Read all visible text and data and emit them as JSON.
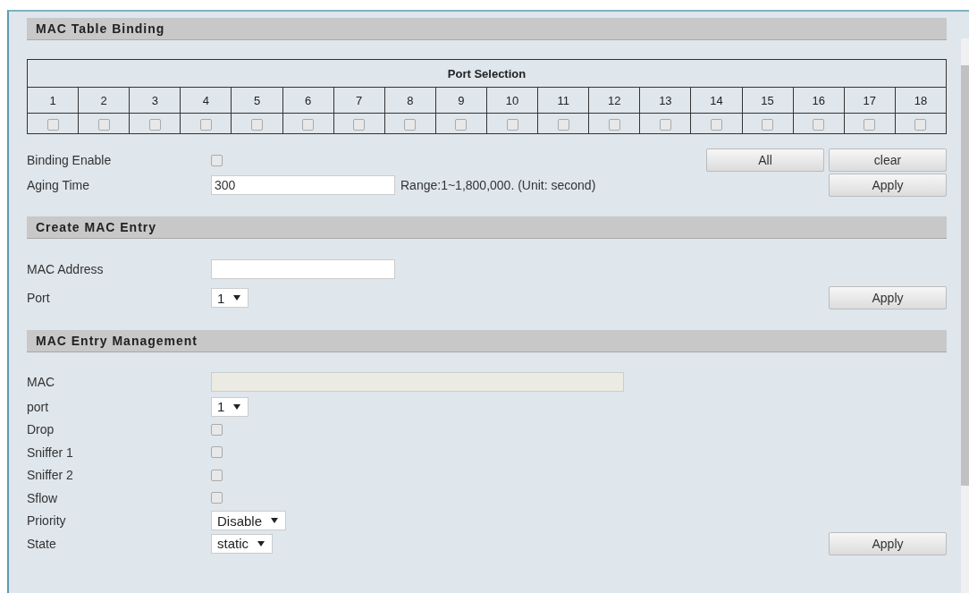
{
  "binding": {
    "title": "MAC Table Binding",
    "port_selection": {
      "title": "Port Selection",
      "ports": [
        {
          "label": "1",
          "checked": false
        },
        {
          "label": "2",
          "checked": false
        },
        {
          "label": "3",
          "checked": false
        },
        {
          "label": "4",
          "checked": false
        },
        {
          "label": "5",
          "checked": false
        },
        {
          "label": "6",
          "checked": false
        },
        {
          "label": "7",
          "checked": false
        },
        {
          "label": "8",
          "checked": false
        },
        {
          "label": "9",
          "checked": false
        },
        {
          "label": "10",
          "checked": false
        },
        {
          "label": "11",
          "checked": false
        },
        {
          "label": "12",
          "checked": false
        },
        {
          "label": "13",
          "checked": false
        },
        {
          "label": "14",
          "checked": false
        },
        {
          "label": "15",
          "checked": false
        },
        {
          "label": "16",
          "checked": false
        },
        {
          "label": "17",
          "checked": false
        },
        {
          "label": "18",
          "checked": false
        }
      ]
    },
    "binding_enable": {
      "label": "Binding Enable",
      "checked": false
    },
    "aging_time": {
      "label": "Aging Time",
      "value": "300",
      "hint": "Range:1~1,800,000. (Unit: second)"
    },
    "buttons": {
      "all": "All",
      "clear": "clear",
      "apply": "Apply"
    }
  },
  "create": {
    "title": "Create MAC Entry",
    "fields": [
      {
        "kind": "text",
        "label": "MAC Address"
      },
      {
        "kind": "select",
        "label": "Port",
        "value": "1"
      }
    ],
    "apply": "Apply"
  },
  "management": {
    "title": "MAC Entry Management",
    "fields": [
      {
        "kind": "readonly",
        "label": "MAC"
      },
      {
        "kind": "select",
        "label": "port",
        "value": "1"
      },
      {
        "kind": "checkbox",
        "label": "Drop",
        "checked": false
      },
      {
        "kind": "checkbox",
        "label": "Sniffer 1",
        "checked": false
      },
      {
        "kind": "checkbox",
        "label": "Sniffer 2",
        "checked": false
      },
      {
        "kind": "checkbox",
        "label": "Sflow",
        "checked": false
      },
      {
        "kind": "select",
        "label": "Priority",
        "value": "Disable"
      },
      {
        "kind": "select",
        "label": "State",
        "value": "static"
      }
    ],
    "apply": "Apply"
  }
}
